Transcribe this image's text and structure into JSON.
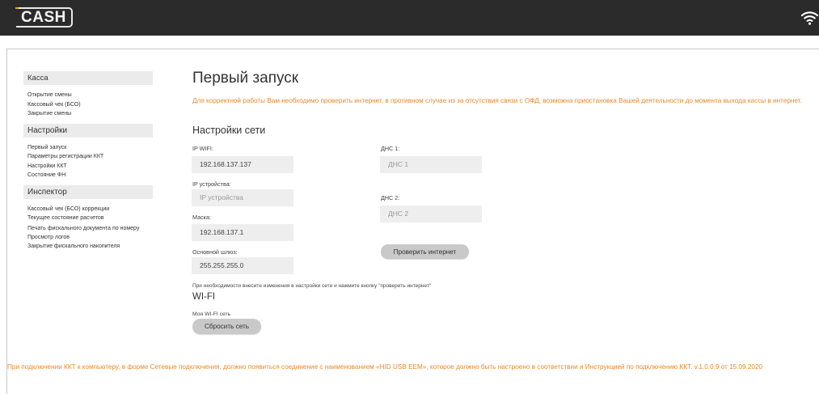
{
  "header": {
    "logo_text": "CASH",
    "wifi_icon": "wifi-icon"
  },
  "sidebar": {
    "sections": [
      {
        "title": "Касса",
        "items": [
          "Открытие смены",
          "Кассовый чек (БСО)",
          "Закрытие смены"
        ]
      },
      {
        "title": "Настройки",
        "items": [
          "Первый запуск",
          "Параметры регистрации ККТ",
          "Настройки ККТ",
          "Состояние ФН"
        ]
      },
      {
        "title": "Инспектор",
        "items": [
          "Кассовый чек (БСО) коррекции",
          "Текущее состояние расчетов",
          "Печать фискального документа по номеру",
          "Просмотр логов",
          "Закрытие фискального накопителя"
        ]
      }
    ]
  },
  "main": {
    "title": "Первый запуск",
    "notice": "Для корректной работы Вам необходимо проверить интернет, в противном случае из за отсутствия связи с ОФД, возможна приостановка Вашей деятельности до момента выхода кассы в интернет.",
    "network_title": "Настройки сети",
    "ip_wifi_label": "IP WIFI:",
    "ip_wifi_value": "192.168.137.137",
    "ip_device_label": "IP устройства:",
    "ip_device_placeholder": "IP устройства",
    "mask_label": "Маска:",
    "mask_value": "192.168.137.1",
    "gateway_label": "Основной шлюз:",
    "gateway_value": "255.255.255.0",
    "dns1_label": "ДНС 1:",
    "dns1_placeholder": "ДНС 1",
    "dns2_label": "ДНС 2:",
    "dns2_placeholder": "ДНС 2",
    "check_button": "Проверить интернет",
    "hint": "При необходимости внесите изменения в настройки сети и нажмите кнопку \"проверить интернет\"",
    "wifi_title": "WI-FI",
    "my_wifi_label": "Моя WI-FI сеть",
    "reset_button": "Сбросить сеть"
  },
  "footer": {
    "text": "При подключении ККТ к компьютеру, в форме Сетевые подключения, должно появиться соединение с наименованием «HID USB EEM», которое должно быть настроено в соответствии и Инструкцией по подключению ККТ. v.1.0.0.9 от 15.09.2020"
  },
  "colors": {
    "topbar": "#2b2b2b",
    "notice": "#e8892c",
    "logo_accent": "#f0a21a"
  }
}
